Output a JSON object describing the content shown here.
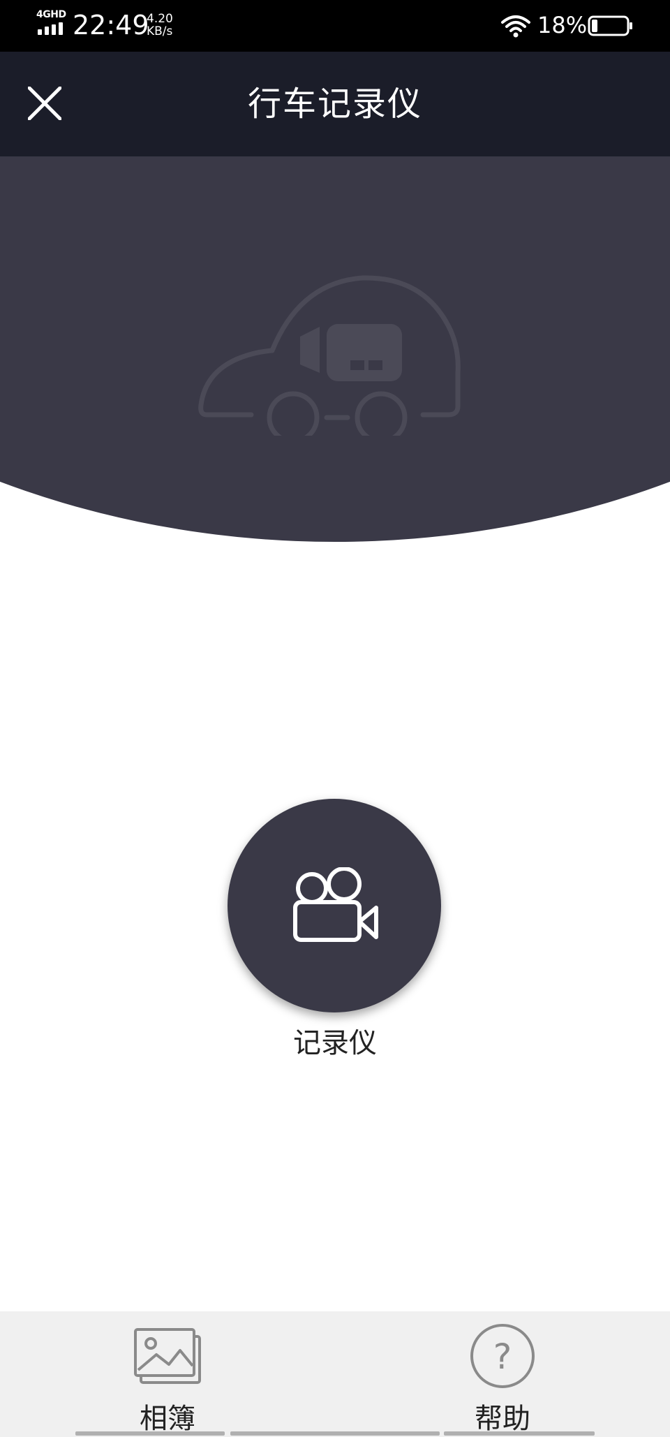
{
  "status_bar": {
    "network_type": "4GHD",
    "time": "22:49",
    "speed_value": "4.20",
    "speed_unit": "KB/s",
    "battery_percent": "18%",
    "icons": [
      "signal-icon",
      "wifi-icon",
      "battery-icon"
    ]
  },
  "header": {
    "title": "行车记录仪",
    "close_icon": "close-icon",
    "background": "#1b1d29"
  },
  "hero": {
    "icon": "car-dashcam-icon",
    "background": "#3a3947"
  },
  "main": {
    "recorder_button": {
      "icon": "video-camera-icon",
      "label": "记录仪"
    }
  },
  "bottom_bar": {
    "tabs": [
      {
        "label": "相簿",
        "icon": "album-icon"
      },
      {
        "label": "帮助",
        "icon": "help-icon"
      }
    ],
    "background": "#f0f0f0"
  }
}
